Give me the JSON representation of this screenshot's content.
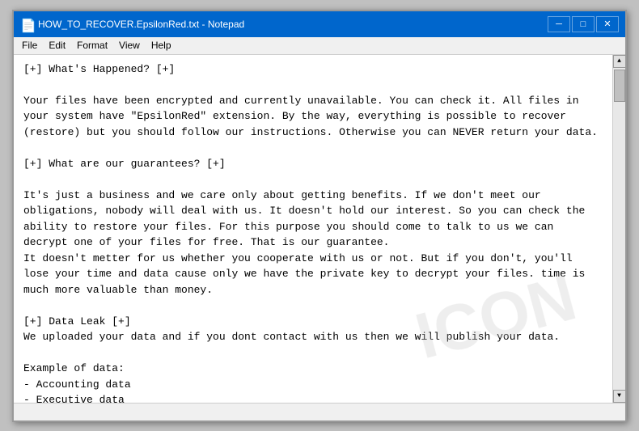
{
  "window": {
    "title": "HOW_TO_RECOVER.EpsilonRed.txt - Notepad",
    "icon": "📄"
  },
  "titlebar": {
    "minimize_label": "─",
    "maximize_label": "□",
    "close_label": "✕"
  },
  "menu": {
    "items": [
      "File",
      "Edit",
      "Format",
      "View",
      "Help"
    ]
  },
  "content": {
    "text": "[+] What's Happened? [+]\n\nYour files have been encrypted and currently unavailable. You can check it. All files in\nyour system have \"EpsilonRed\" extension. By the way, everything is possible to recover\n(restore) but you should follow our instructions. Otherwise you can NEVER return your data.\n\n[+] What are our guarantees? [+]\n\nIt's just a business and we care only about getting benefits. If we don't meet our\nobligations, nobody will deal with us. It doesn't hold our interest. So you can check the\nability to restore your files. For this purpose you should come to talk to us we can\ndecrypt one of your files for free. That is our guarantee.\nIt doesn't metter for us whether you cooperate with us or not. But if you don't, you'll\nlose your time and data cause only we have the private key to decrypt your files. time is\nmuch more valuable than money.\n\n[+] Data Leak [+]\nWe uploaded your data and if you dont contact with us then we will publish your data.\n\nExample of data:\n- Accounting data\n- Executive data\n- Sales data\n- Customer support data\n- Marketing data\n- And more other ..."
  },
  "watermark": {
    "text": "ICON"
  },
  "statusbar": {
    "text": ""
  }
}
